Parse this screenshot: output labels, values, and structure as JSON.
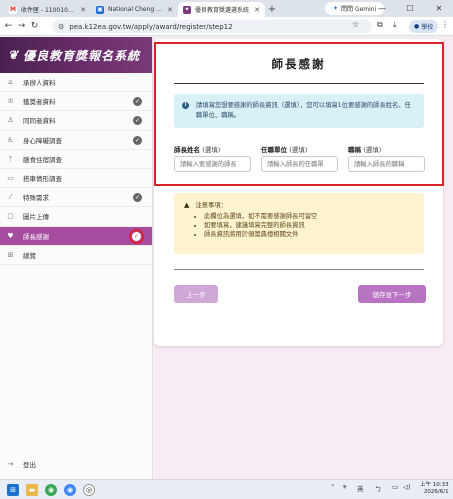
{
  "browser": {
    "tabs": [
      {
        "title": "收件匣 - 11001034@",
        "icon": "gmail-icon",
        "color": "#d93025",
        "active": false
      },
      {
        "title": "National Cheng Kung",
        "icon": "ncku-icon",
        "color": "#1967d2",
        "active": false
      },
      {
        "title": "優良教育獎遴選系統",
        "icon": "award-icon",
        "color": "#7a3a79",
        "active": true
      }
    ],
    "new_tab": "+",
    "gemini_label": "問問 Gemini",
    "url": "pea.k12ea.gov.tw/apply/award/register/step12",
    "profile_label": "學校"
  },
  "sidebar": {
    "brand": "優良教育獎報名系統",
    "items": [
      {
        "label": "承辦人資料",
        "icon": "house-icon",
        "checked": false,
        "active": false
      },
      {
        "label": "獲獎者資料",
        "icon": "trophy-icon",
        "checked": true,
        "active": false
      },
      {
        "label": "同同者資料",
        "icon": "person-icon",
        "checked": true,
        "active": false
      },
      {
        "label": "身心障礙調查",
        "icon": "accessibility-icon",
        "checked": true,
        "active": false
      },
      {
        "label": "膳食住宿調查",
        "icon": "utensils-icon",
        "checked": false,
        "active": false
      },
      {
        "label": "搭車情形調查",
        "icon": "bus-icon",
        "checked": false,
        "active": false
      },
      {
        "label": "特殊需求",
        "icon": "wand-icon",
        "checked": true,
        "active": false
      },
      {
        "label": "圖片上傳",
        "icon": "image-icon",
        "checked": false,
        "active": false
      },
      {
        "label": "師長感謝",
        "icon": "heart-icon",
        "checked": true,
        "active": true
      },
      {
        "label": "總覽",
        "icon": "grid-icon",
        "checked": false,
        "active": false
      }
    ],
    "logout": "登出"
  },
  "main": {
    "title": "師長感謝",
    "info_text": "請填寫您想要感謝的師長資訊（選填），您可以填寫1位要感謝的師長姓名、任職單位、職稱。",
    "fields": [
      {
        "label": "師長姓名",
        "optional": "(選填)",
        "placeholder": "請輸入要感謝的師長"
      },
      {
        "label": "任職單位",
        "optional": "(選填)",
        "placeholder": "請輸入師長的任職單"
      },
      {
        "label": "職稱",
        "optional": "(選填)",
        "placeholder": "請輸入師長的職稱"
      }
    ],
    "notice_title": "注意事項：",
    "notice_items": [
      "此欄位為選填，如不需要感謝師長可留空",
      "如要填寫，建議填寫完整的師長資訊",
      "師長資訊將用於頒獎典禮相關文件"
    ],
    "prev_button": "上一步",
    "next_button": "儲存並下一步"
  },
  "taskbar": {
    "tray_lang": "英",
    "time": "上午 10:33",
    "date": "2026/6/1"
  }
}
